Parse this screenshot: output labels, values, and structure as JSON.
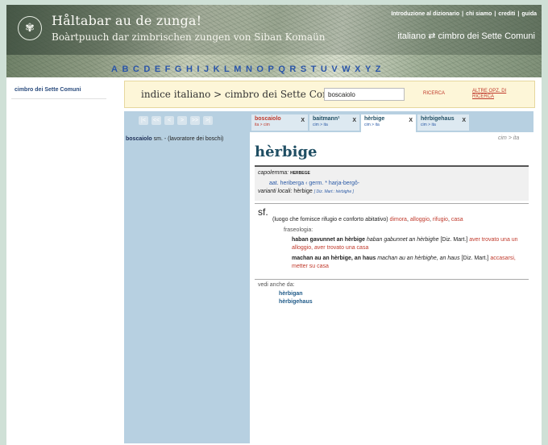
{
  "banner": {
    "title": "Håltabar au de zunga!",
    "subtitle": "Boàrtpuuch dar zimbrischen zungen von Siban Komaün",
    "nav": [
      "Introduzione al dizionario",
      "chi siamo",
      "crediti",
      "guida"
    ],
    "lang_pair": "italiano ⇄ cimbro dei Sette Comuni",
    "alphabet": [
      "A",
      "B",
      "C",
      "D",
      "E",
      "F",
      "G",
      "H",
      "I",
      "J",
      "K",
      "L",
      "M",
      "N",
      "O",
      "P",
      "Q",
      "R",
      "S",
      "T",
      "U",
      "V",
      "W",
      "X",
      "Y",
      "Z"
    ]
  },
  "sidebar": {
    "link": "cimbro dei Sette Comuni"
  },
  "search": {
    "title": "indice italiano > cimbro dei Sette Comuni",
    "query": "boscaiolo",
    "button": "RICERCA",
    "more": "ALTRE OPZ. DI RICERCA"
  },
  "pager": [
    "|<",
    "<<",
    "<",
    ">",
    ">>",
    ">|"
  ],
  "results": [
    {
      "word": "boscaiolo",
      "gloss": "sm. - (lavoratore dei boschi)"
    }
  ],
  "tabs": [
    {
      "name": "boscaiolo",
      "dir": "ita > cim",
      "close": "X"
    },
    {
      "name": "baitmann¹",
      "dir": "cim > ita",
      "close": "X"
    },
    {
      "name": "hèrbige",
      "dir": "cim > ita",
      "close": "X"
    },
    {
      "name": "hèrbigehaus",
      "dir": "cim > ita",
      "close": "X"
    }
  ],
  "entry": {
    "direction": "cim > ita",
    "headword": "hèrbige",
    "capolemma_label": "capolemma:",
    "capolemma_value": "HERBEGE",
    "etymology": "aat. heriberga ‹ germ. * harja-bergô-",
    "varianti_label": "varianti locali:",
    "varianti_value": "hèrbige",
    "varianti_ref": "[ Diz. Mart.: hèrbighe ]",
    "pos": "sf.",
    "definition_text": "(luogo che fornisce rifugio e conforto abitativo)",
    "translations": [
      "dimora",
      "alloggio",
      "rifugio",
      "casa"
    ],
    "fraseologia_label": "fraseologia:",
    "phrases": [
      {
        "cim": "haban gavunnet an hèrbige",
        "alt": "haban gabunnet an hèrbighe",
        "ref": "[Diz. Mart.]",
        "ita": "aver trovato una un alloggio, aver trovato una casa"
      },
      {
        "cim": "machan au an hèrbige, an haus",
        "alt": "machan au an hèrbighe, an haus",
        "ref": "[Diz. Mart.]",
        "ita": "accasarsi, metter su casa"
      }
    ],
    "vedi_label": "vedi anche da:",
    "vedi_links": [
      "hèrbigan",
      "hèrbigehaus"
    ]
  }
}
